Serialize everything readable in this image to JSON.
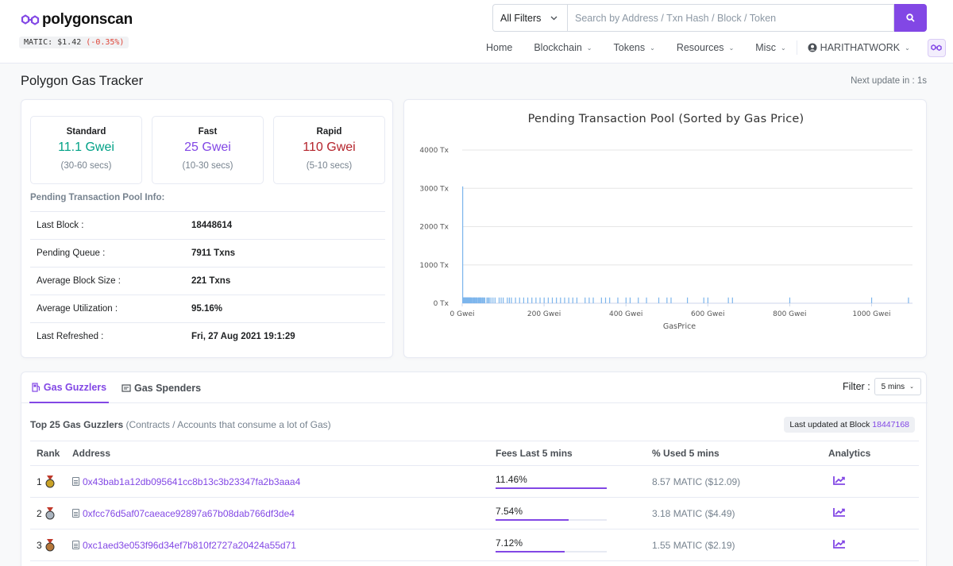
{
  "brand": {
    "name": "polygonscan",
    "price_label": "MATIC: $1.42",
    "price_change": "(-0.35%)"
  },
  "search": {
    "filter_label": "All Filters",
    "placeholder": "Search by Address / Txn Hash / Block / Token"
  },
  "nav": {
    "items": [
      "Home",
      "Blockchain",
      "Tokens",
      "Resources",
      "Misc"
    ],
    "user": "HARITHATWORK"
  },
  "page": {
    "title": "Polygon Gas Tracker",
    "next_update": "Next update in : 1s"
  },
  "gas": {
    "standard": {
      "title": "Standard",
      "value": "11.1 Gwei",
      "time": "(30-60 secs)"
    },
    "fast": {
      "title": "Fast",
      "value": "25 Gwei",
      "time": "(10-30 secs)"
    },
    "rapid": {
      "title": "Rapid",
      "value": "110 Gwei",
      "time": "(5-10 secs)"
    }
  },
  "pool_info": {
    "title": "Pending Transaction Pool Info:",
    "rows": [
      {
        "key": "Last Block :",
        "value": "18448614"
      },
      {
        "key": "Pending Queue :",
        "value": "7911 Txns"
      },
      {
        "key": "Average Block Size :",
        "value": "221 Txns"
      },
      {
        "key": "Average Utilization :",
        "value": "95.16%"
      },
      {
        "key": "Last Refreshed :",
        "value": "Fri, 27 Aug 2021 19:1:29"
      }
    ]
  },
  "chart_data": {
    "type": "bar",
    "title": "Pending Transaction Pool (Sorted by Gas Price)",
    "xlabel": "GasPrice",
    "ylabel": "",
    "xlim": [
      0,
      1100
    ],
    "ylim": [
      0,
      4000
    ],
    "x_ticks": [
      "0 Gwei",
      "200 Gwei",
      "400 Gwei",
      "600 Gwei",
      "800 Gwei",
      "1000 Gwei"
    ],
    "y_ticks": [
      "0 Tx",
      "1000 Tx",
      "2000 Tx",
      "3000 Tx",
      "4000 Tx"
    ],
    "x": [
      1,
      2,
      3,
      4,
      5,
      6,
      7,
      8,
      9,
      10,
      11,
      12,
      13,
      14,
      15,
      16,
      17,
      18,
      19,
      20,
      22,
      25,
      28,
      30,
      33,
      35,
      40,
      42,
      45,
      50,
      55,
      60,
      63,
      66,
      70,
      75,
      80,
      90,
      95,
      100,
      110,
      115,
      120,
      130,
      140,
      150,
      160,
      170,
      180,
      190,
      200,
      210,
      220,
      230,
      240,
      250,
      260,
      270,
      280,
      300,
      310,
      320,
      340,
      350,
      360,
      380,
      400,
      410,
      430,
      450,
      480,
      500,
      510,
      550,
      590,
      600,
      650,
      660,
      800,
      1000,
      1090
    ],
    "values": [
      3050,
      150,
      150,
      150,
      150,
      150,
      150,
      150,
      150,
      150,
      150,
      150,
      150,
      150,
      150,
      150,
      150,
      150,
      150,
      150,
      150,
      150,
      150,
      150,
      150,
      150,
      150,
      150,
      150,
      150,
      150,
      150,
      150,
      150,
      150,
      150,
      150,
      150,
      150,
      150,
      150,
      150,
      150,
      150,
      150,
      150,
      150,
      150,
      150,
      150,
      150,
      150,
      150,
      150,
      150,
      150,
      150,
      150,
      150,
      150,
      150,
      150,
      150,
      150,
      150,
      150,
      150,
      150,
      150,
      150,
      150,
      150,
      150,
      150,
      150,
      150,
      150,
      150,
      150,
      150,
      150
    ],
    "color": "#7cb5ec",
    "grid": true
  },
  "tabs": {
    "guzzlers": "Gas Guzzlers",
    "spenders": "Gas Spenders"
  },
  "filter": {
    "label": "Filter :",
    "value": "5 mins"
  },
  "guzzlers": {
    "heading": "Top 25 Gas Guzzlers",
    "subheading": "(Contracts / Accounts that consume a lot of Gas)",
    "last_updated_label": "Last updated at Block",
    "last_updated_block": "18447168",
    "columns": [
      "Rank",
      "Address",
      "Fees Last 5 mins",
      "% Used 5 mins",
      "Analytics"
    ],
    "rows": [
      {
        "rank": "1",
        "medal_color": "#c9a227",
        "address": "0x43bab1a12db095641cc8b13c3b23347fa2b3aaa4",
        "fees": "11.46%",
        "fees_pct": 100,
        "used": "8.57 MATIC ($12.09)"
      },
      {
        "rank": "2",
        "medal_color": "#aab4bf",
        "address": "0xfcc76d5af07caeace92897a67b08dab766df3de4",
        "fees": "7.54%",
        "fees_pct": 66,
        "used": "3.18 MATIC ($4.49)"
      },
      {
        "rank": "3",
        "medal_color": "#b5773a",
        "address": "0xc1aed3e053f96d34ef7b810f2727a20424a55d71",
        "fees": "7.12%",
        "fees_pct": 62,
        "used": "1.55 MATIC ($2.19)"
      }
    ]
  },
  "colors": {
    "accent": "#8247e5",
    "standard": "#00a186",
    "rapid": "#b4232b",
    "chart_bar": "#7cb5ec"
  }
}
